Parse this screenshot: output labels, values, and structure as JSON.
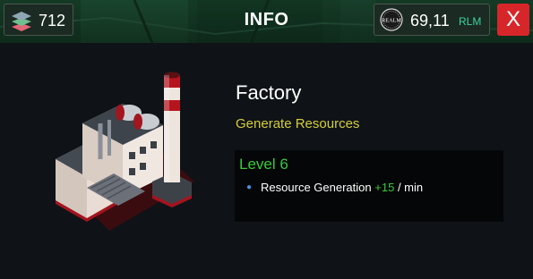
{
  "header": {
    "title": "INFO",
    "resources": {
      "count": "712",
      "icon": "layers-icon"
    },
    "balance": {
      "value": "69,11",
      "unit": "RLM",
      "coin_text": "REALM",
      "icon": "realm-coin-icon"
    },
    "close_label": "X"
  },
  "building": {
    "name": "Factory",
    "description": "Generate Resources",
    "image": "factory-illustration"
  },
  "level_panel": {
    "level": "Level 6",
    "stats": [
      {
        "label": "Resource Generation",
        "bonus": "+15",
        "unit": "/ min"
      }
    ]
  },
  "colors": {
    "background": "#0f1317",
    "accent_green": "#38c93a",
    "description_yellow": "#d4cd3d",
    "balance_unit": "#3dd4a0",
    "close_red": "#d7262a"
  }
}
